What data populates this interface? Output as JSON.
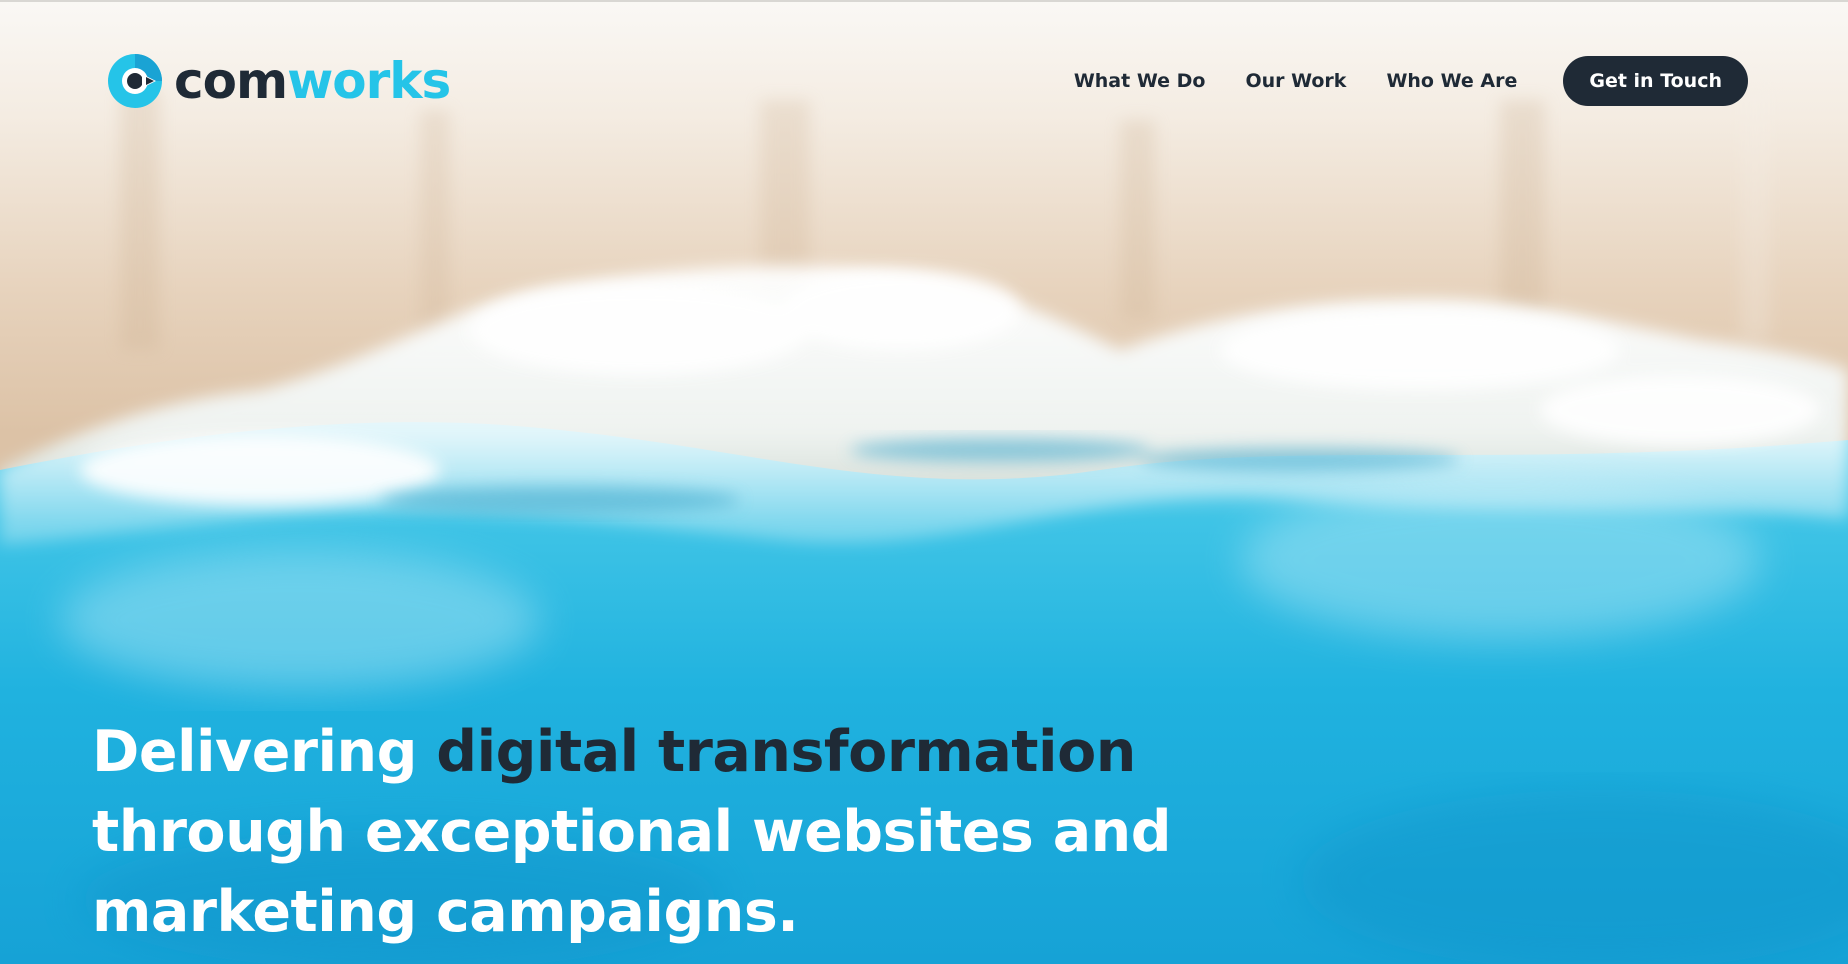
{
  "brand": {
    "logo_text_dark": "com",
    "logo_text_light": "works",
    "colors": {
      "dark": "#1f2a36",
      "accent": "#25c4e8"
    }
  },
  "nav": {
    "items": [
      {
        "label": "What We Do"
      },
      {
        "label": "Our Work"
      },
      {
        "label": "Who We Are"
      }
    ],
    "cta_label": "Get in Touch"
  },
  "hero": {
    "headline_lead": "Delivering",
    "headline_accent": "digital transformation",
    "headline_line2": "through exceptional websites and",
    "headline_line3": "marketing campaigns.",
    "background": "aerial-beach-waves-image"
  }
}
